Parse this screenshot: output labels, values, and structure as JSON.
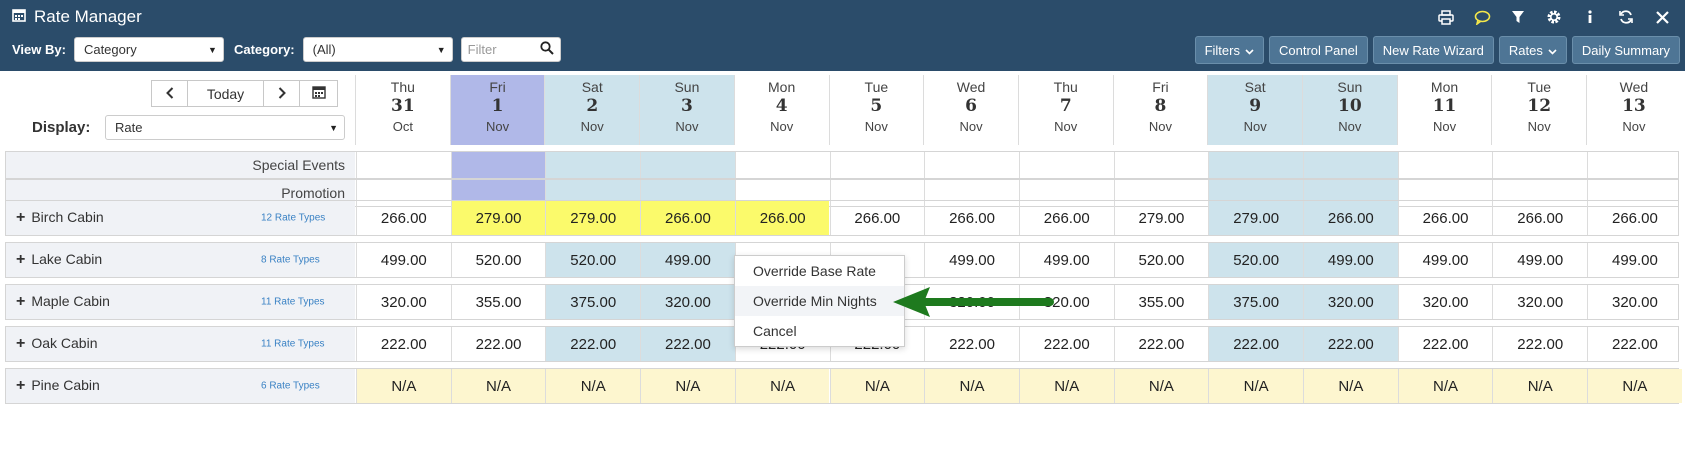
{
  "app": {
    "title": "Rate Manager"
  },
  "toolbar": {
    "view_by_label": "View By:",
    "view_by_value": "Category",
    "category_label": "Category:",
    "category_value": "(All)",
    "filter_placeholder": "Filter",
    "buttons": [
      "Filters",
      "Control Panel",
      "New Rate Wizard",
      "Rates",
      "Daily Summary"
    ]
  },
  "header_icons": [
    "print-icon",
    "comment-icon",
    "filter-icon",
    "gear-icon",
    "info-icon",
    "refresh-icon",
    "close-icon"
  ],
  "nav": {
    "today": "Today"
  },
  "display": {
    "label": "Display:",
    "value": "Rate"
  },
  "days": [
    {
      "dow": "Thu",
      "date": "31",
      "mon": "Oct"
    },
    {
      "dow": "Fri",
      "date": "1",
      "mon": "Nov"
    },
    {
      "dow": "Sat",
      "date": "2",
      "mon": "Nov"
    },
    {
      "dow": "Sun",
      "date": "3",
      "mon": "Nov"
    },
    {
      "dow": "Mon",
      "date": "4",
      "mon": "Nov"
    },
    {
      "dow": "Tue",
      "date": "5",
      "mon": "Nov"
    },
    {
      "dow": "Wed",
      "date": "6",
      "mon": "Nov"
    },
    {
      "dow": "Thu",
      "date": "7",
      "mon": "Nov"
    },
    {
      "dow": "Fri",
      "date": "8",
      "mon": "Nov"
    },
    {
      "dow": "Sat",
      "date": "9",
      "mon": "Nov"
    },
    {
      "dow": "Sun",
      "date": "10",
      "mon": "Nov"
    },
    {
      "dow": "Mon",
      "date": "11",
      "mon": "Nov"
    },
    {
      "dow": "Tue",
      "date": "12",
      "mon": "Nov"
    },
    {
      "dow": "Wed",
      "date": "13",
      "mon": "Nov"
    }
  ],
  "event_rows": [
    "Special Events",
    "Promotion"
  ],
  "cabins": [
    {
      "name": "Birch Cabin",
      "rate_types": "12 Rate Types",
      "values": [
        "266.00",
        "279.00",
        "279.00",
        "266.00",
        "266.00",
        "266.00",
        "266.00",
        "266.00",
        "279.00",
        "279.00",
        "266.00",
        "266.00",
        "266.00",
        "266.00"
      ]
    },
    {
      "name": "Lake Cabin",
      "rate_types": "8 Rate Types",
      "values": [
        "499.00",
        "520.00",
        "520.00",
        "499.00",
        "",
        "",
        "499.00",
        "499.00",
        "520.00",
        "520.00",
        "499.00",
        "499.00",
        "499.00",
        "499.00"
      ]
    },
    {
      "name": "Maple Cabin",
      "rate_types": "11 Rate Types",
      "values": [
        "320.00",
        "355.00",
        "375.00",
        "320.00",
        "",
        "",
        "320.00",
        "320.00",
        "355.00",
        "375.00",
        "320.00",
        "320.00",
        "320.00",
        "320.00"
      ]
    },
    {
      "name": "Oak Cabin",
      "rate_types": "11 Rate Types",
      "values": [
        "222.00",
        "222.00",
        "222.00",
        "222.00",
        "222.00",
        "222.00",
        "222.00",
        "222.00",
        "222.00",
        "222.00",
        "222.00",
        "222.00",
        "222.00",
        "222.00"
      ]
    },
    {
      "name": "Pine Cabin",
      "rate_types": "6 Rate Types",
      "values": [
        "N/A",
        "N/A",
        "N/A",
        "N/A",
        "N/A",
        "N/A",
        "N/A",
        "N/A",
        "N/A",
        "N/A",
        "N/A",
        "N/A",
        "N/A",
        "N/A"
      ]
    }
  ],
  "context_menu": {
    "items": [
      "Override Base Rate",
      "Override Min Nights",
      "Cancel"
    ],
    "highlighted_index": 1
  },
  "colors": {
    "header_bg": "#2b4c6a",
    "weekend": "#cde3ec",
    "selected_day": "#b0b8e8",
    "edited_cell": "#fbfa6b",
    "na_cell": "#fdf6cf",
    "arrow": "#1e7a1e",
    "link": "#3a82c4"
  }
}
